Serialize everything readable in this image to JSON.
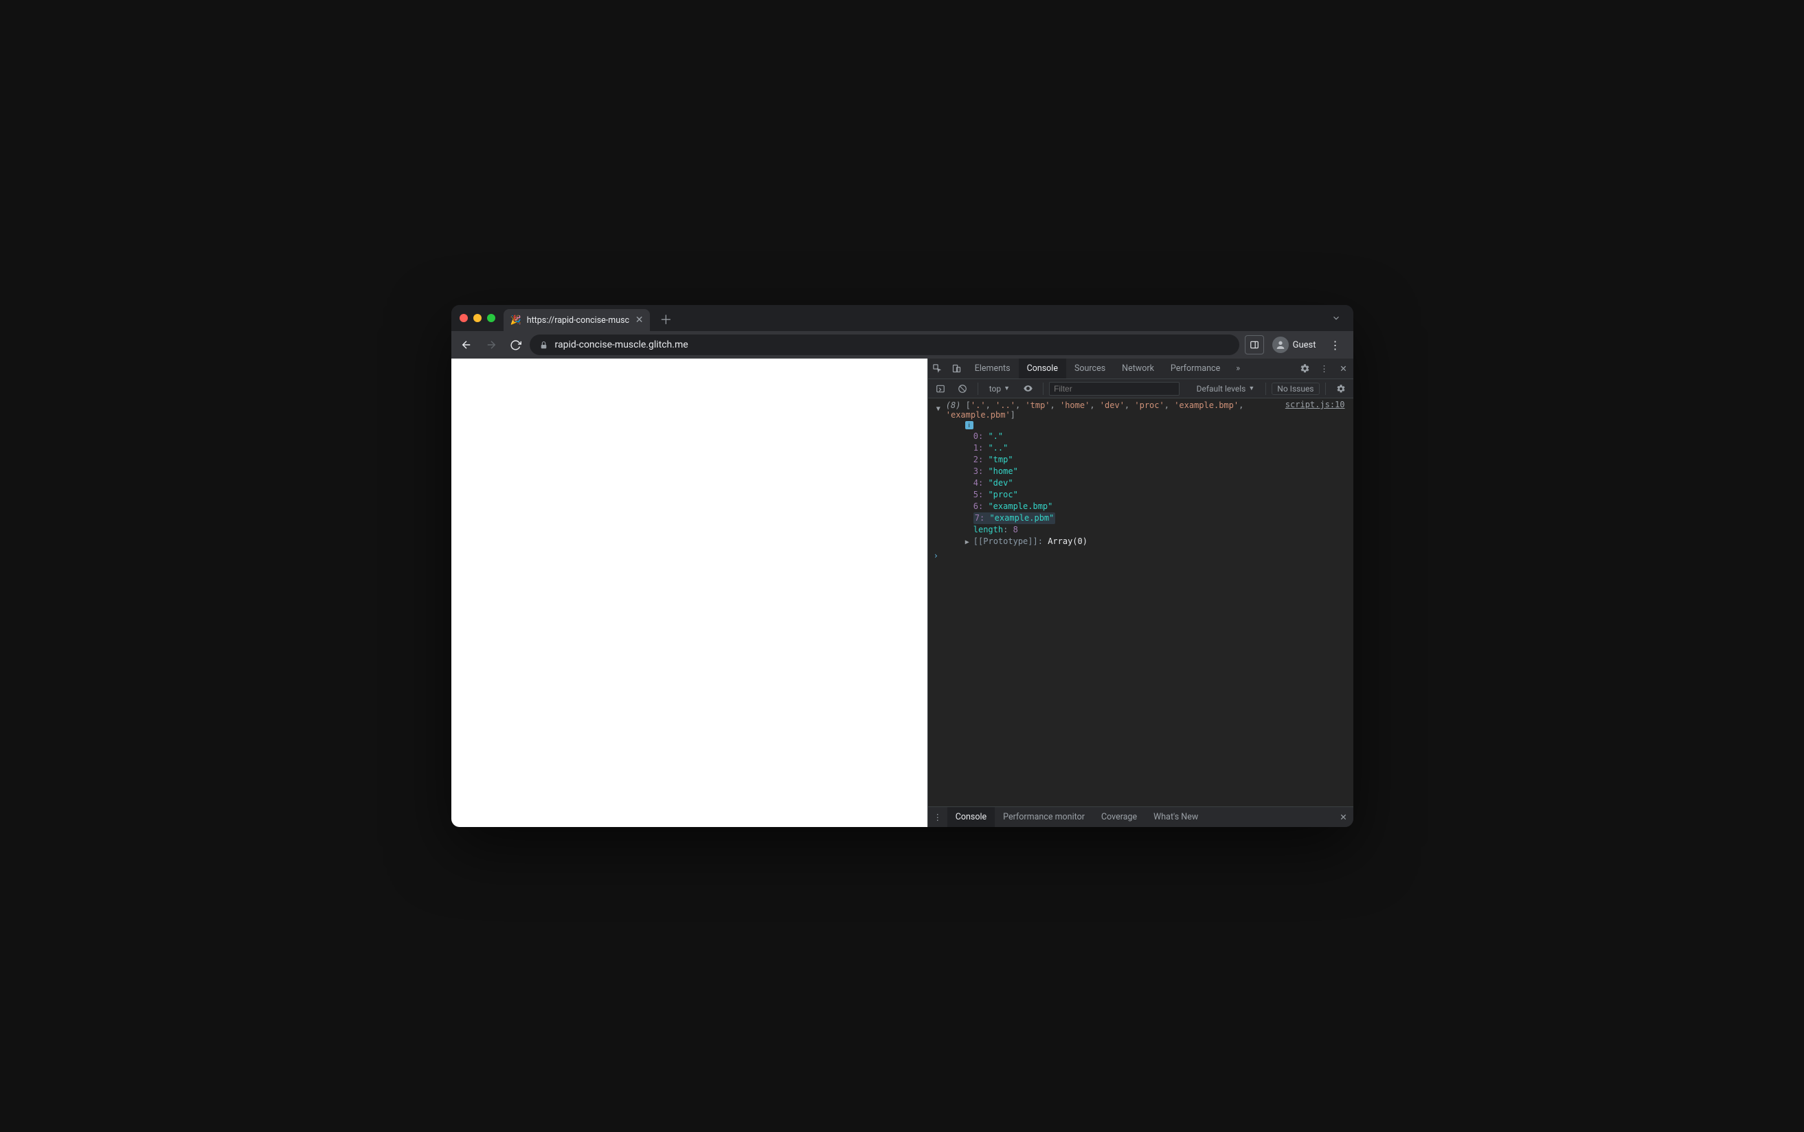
{
  "tab": {
    "favicon": "🎉",
    "title": "https://rapid-concise-muscle.g"
  },
  "toolbar": {
    "url": "rapid-concise-muscle.glitch.me",
    "guest_label": "Guest"
  },
  "devtools": {
    "tabs": {
      "elements": "Elements",
      "console": "Console",
      "sources": "Sources",
      "network": "Network",
      "performance": "Performance"
    },
    "console_toolbar": {
      "context": "top",
      "filter_placeholder": "Filter",
      "levels": "Default levels",
      "issues": "No Issues"
    },
    "source_link": "script.js:10",
    "array": {
      "length_badge": "(8)",
      "items": [
        ".",
        "..",
        "tmp",
        "home",
        "dev",
        "proc",
        "example.bmp",
        "example.pbm"
      ],
      "length_label": "length",
      "length_value": "8",
      "prototype_label": "[[Prototype]]",
      "prototype_value": "Array(0)",
      "highlighted_index": 7
    },
    "drawer": {
      "console": "Console",
      "perfmon": "Performance monitor",
      "coverage": "Coverage",
      "whatsnew": "What's New"
    }
  }
}
